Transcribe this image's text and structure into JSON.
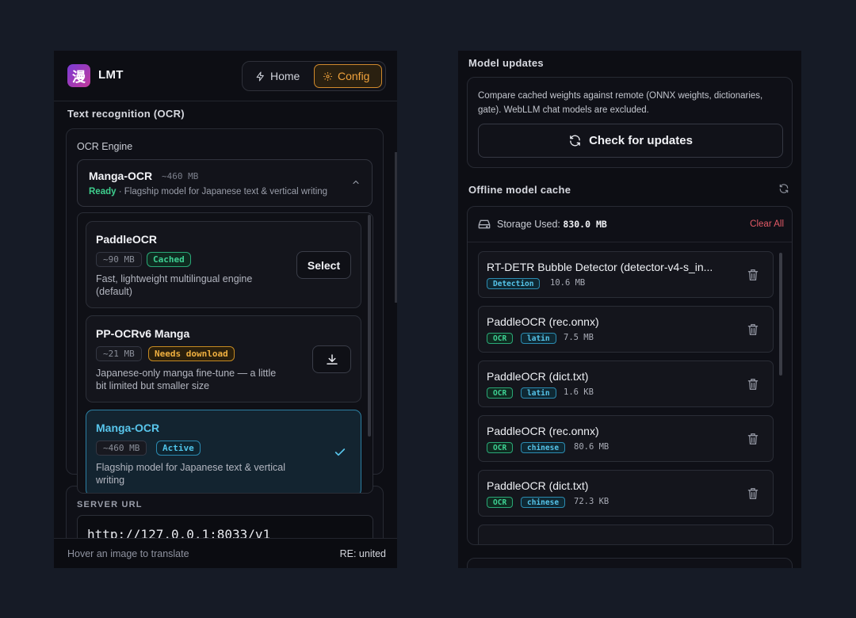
{
  "left": {
    "brand": {
      "logo_glyph": "漫",
      "name": "LMT"
    },
    "nav": {
      "home_label": "Home",
      "config_label": "Config"
    },
    "section_title": "Text recognition (OCR)",
    "engine": {
      "label": "OCR Engine",
      "selected_name": "Manga-OCR",
      "selected_size": "~460 MB",
      "selected_status": "Ready",
      "selected_desc": "· Flagship model for Japanese text & vertical writing"
    },
    "options": [
      {
        "name": "PaddleOCR",
        "size": "~90 MB",
        "badge": "Cached",
        "desc": "Fast, lightweight multilingual engine (default)",
        "action": "Select"
      },
      {
        "name": "PP-OCRv6 Manga",
        "size": "~21 MB",
        "badge": "Needs download",
        "desc": "Japanese-only manga fine-tune — a little bit limited but smaller size"
      },
      {
        "name": "Manga-OCR",
        "size": "~460 MB",
        "badge": "Active",
        "desc": "Flagship model for Japanese text & vertical writing"
      }
    ],
    "server": {
      "label": "SERVER URL",
      "value": "http://127.0.0.1:8033/v1"
    },
    "footer": {
      "left": "Hover an image to translate",
      "right": "RE: united"
    }
  },
  "right": {
    "updates": {
      "title": "Model updates",
      "desc": "Compare cached weights against remote (ONNX weights, dictionaries, gate). WebLLM chat models are excluded.",
      "button": "Check for updates"
    },
    "cache": {
      "title": "Offline model cache",
      "storage_label": "Storage Used:",
      "storage_value": "830.0 MB",
      "clear_all": "Clear All",
      "items": [
        {
          "name": "RT-DETR Bubble Detector (detector-v4-s_in...",
          "tags": [
            "Detection"
          ],
          "size": "10.6 MB"
        },
        {
          "name": "PaddleOCR (rec.onnx)",
          "tags": [
            "OCR",
            "latin"
          ],
          "size": "7.5 MB"
        },
        {
          "name": "PaddleOCR (dict.txt)",
          "tags": [
            "OCR",
            "latin"
          ],
          "size": "1.6 KB"
        },
        {
          "name": "PaddleOCR (rec.onnx)",
          "tags": [
            "OCR",
            "chinese"
          ],
          "size": "80.6 MB"
        },
        {
          "name": "PaddleOCR (dict.txt)",
          "tags": [
            "OCR",
            "chinese"
          ],
          "size": "72.3 KB"
        }
      ]
    }
  },
  "colors": {
    "accent": "#f0a23c",
    "ready": "#3ecf8e",
    "active": "#58c6ec",
    "danger": "#e35a66"
  },
  "icons": [
    "zap-icon",
    "gear-icon",
    "chevron-up-icon",
    "download-icon",
    "check-icon",
    "refresh-icon",
    "hard-drive-icon",
    "trash-icon"
  ]
}
